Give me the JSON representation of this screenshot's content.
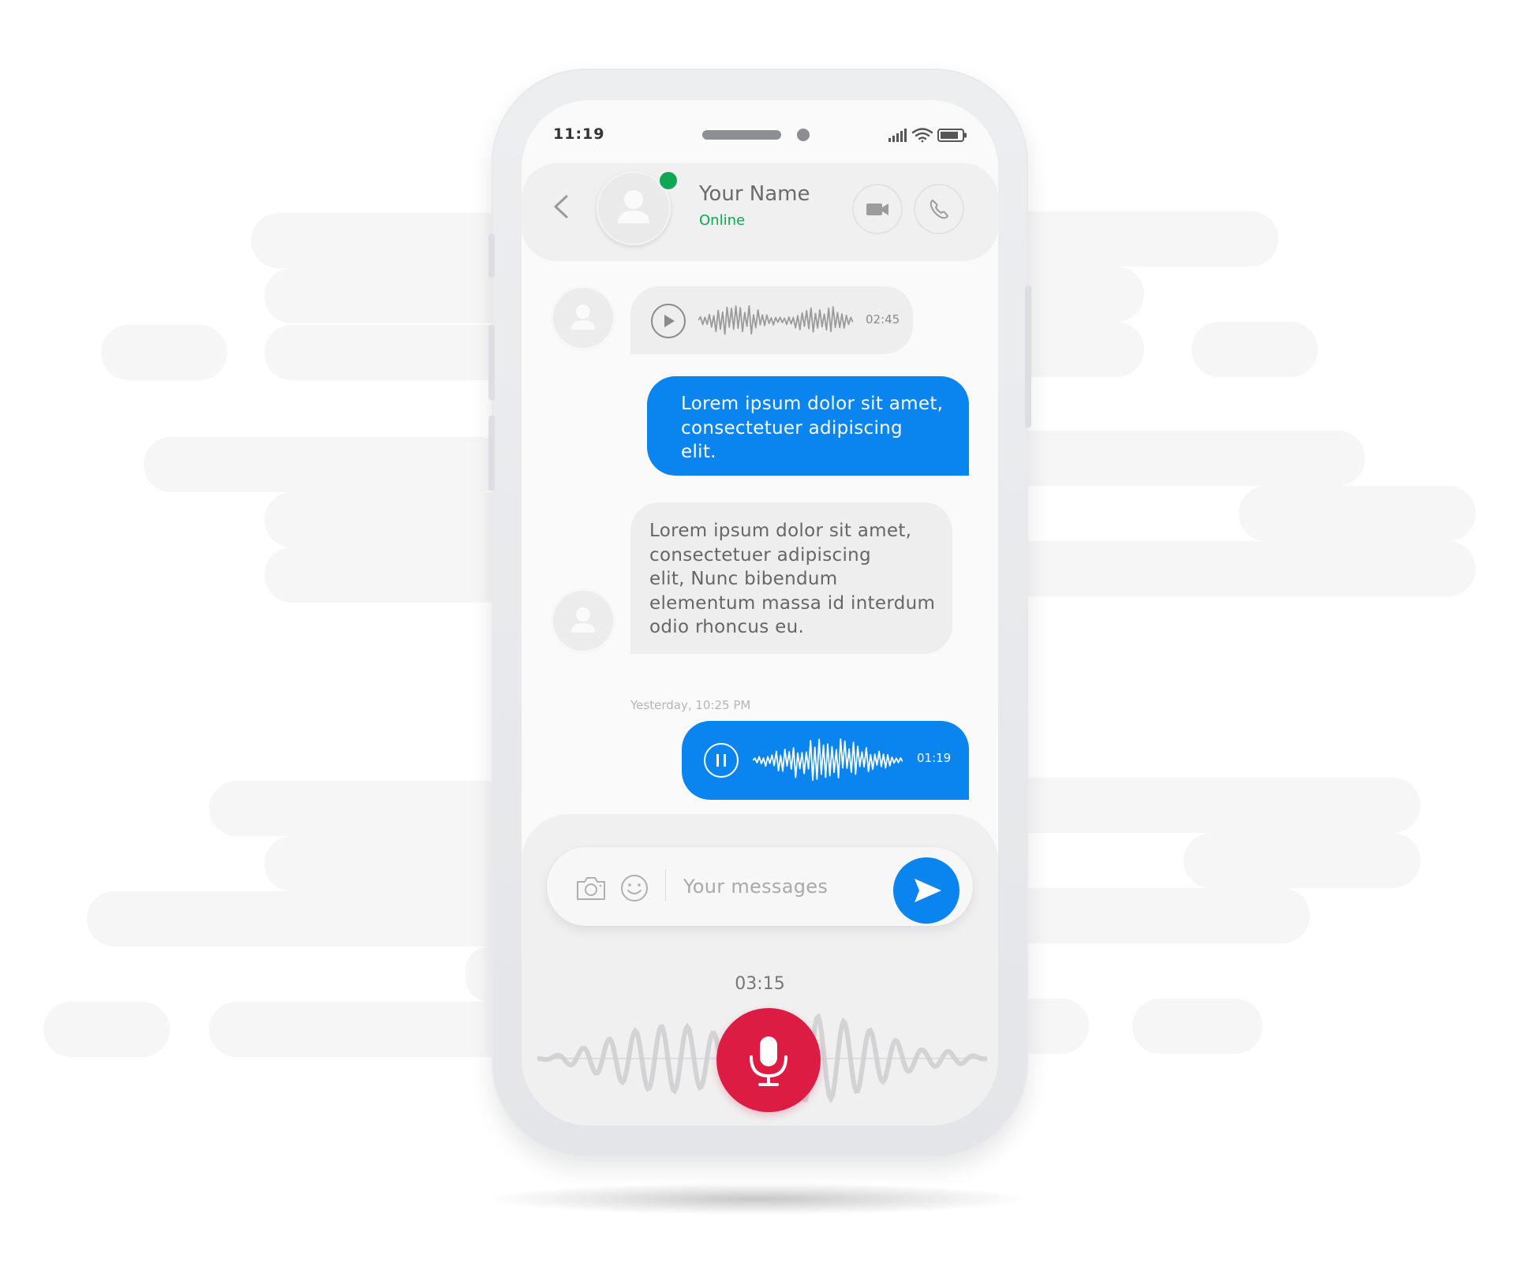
{
  "status_bar": {
    "time": "11:19"
  },
  "header": {
    "contact_name": "Your Name",
    "contact_status": "Online"
  },
  "messages": [
    {
      "type": "audio",
      "direction": "incoming",
      "duration": "02:45"
    },
    {
      "type": "text",
      "direction": "outgoing",
      "lines": [
        "Lorem ipsum dolor sit amet,",
        "consectetuer adipiscing",
        "elit."
      ]
    },
    {
      "type": "text",
      "direction": "incoming",
      "lines": [
        "Lorem ipsum dolor sit amet,",
        "consectetuer adipiscing",
        "elit, Nunc bibendum",
        "elementum massa id interdum",
        "odio rhoncus eu."
      ]
    },
    {
      "type": "timestamp",
      "text": "Yesterday, 10:25 PM"
    },
    {
      "type": "audio",
      "direction": "outgoing",
      "duration": "01:19"
    }
  ],
  "composer": {
    "placeholder": "Your messages"
  },
  "recording": {
    "elapsed": "03:15"
  },
  "icons": [
    "back-arrow-icon",
    "user-icon",
    "video-camera-icon",
    "phone-icon",
    "play-icon",
    "pause-icon",
    "camera-icon",
    "emoji-icon",
    "send-icon",
    "microphone-icon",
    "signal-icon",
    "wifi-icon",
    "battery-icon"
  ],
  "colors": {
    "accent_blue": "#0a84ef",
    "online_green": "#0fa753",
    "record_red": "#dc1c43"
  }
}
